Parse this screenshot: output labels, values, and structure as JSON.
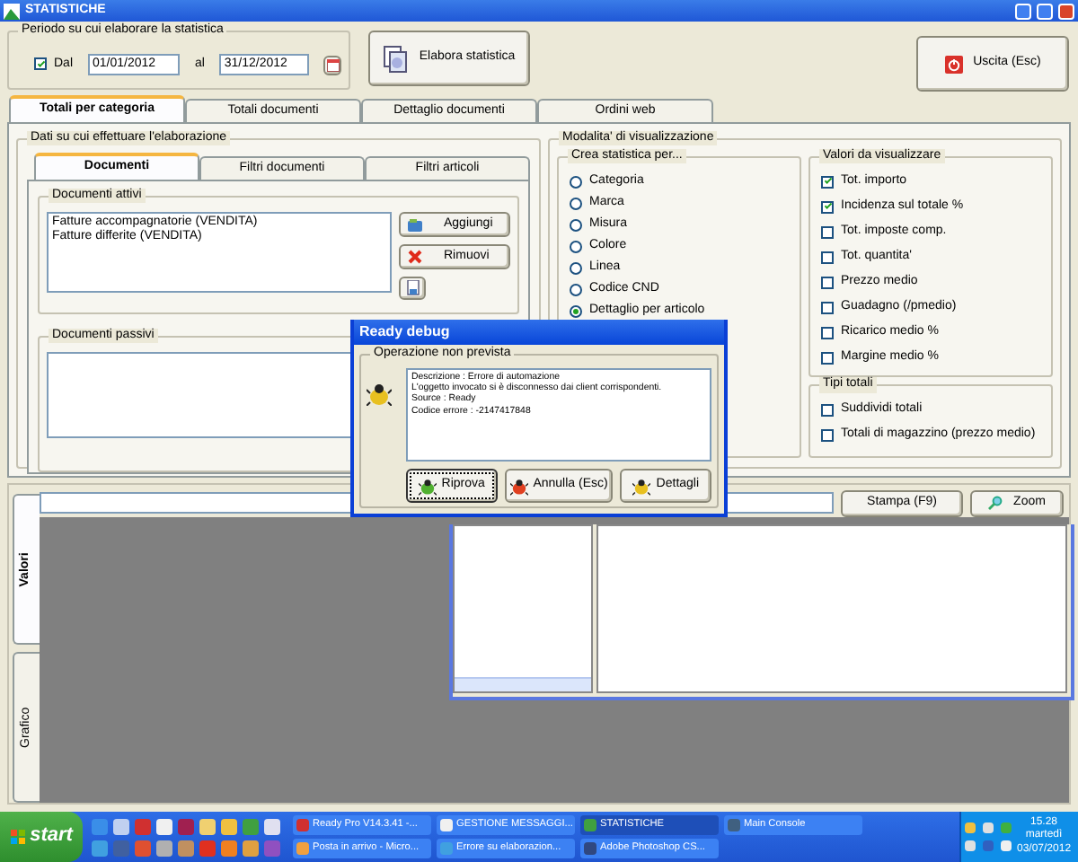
{
  "window": {
    "title": "STATISTICHE"
  },
  "period": {
    "legend": "Periodo su cui elaborare la statistica",
    "from_checked": true,
    "from_label": "Dal",
    "from": "01/01/2012",
    "to_label": "al",
    "to": "31/12/2012"
  },
  "actions": [
    {
      "label": "Elabora statistica",
      "kind": "process"
    },
    {
      "label": "Uscita (Esc)",
      "kind": "exit"
    }
  ],
  "tabs": [
    {
      "label": "Totali per categoria",
      "selected": true
    },
    {
      "label": "Totali documenti",
      "selected": false
    },
    {
      "label": "Dettaglio documenti",
      "selected": false
    },
    {
      "label": "Ordini web",
      "selected": false
    }
  ],
  "data_group": {
    "legend": "Dati su cui effettuare l'elaborazione",
    "tabs": [
      {
        "label": "Documenti",
        "selected": true
      },
      {
        "label": "Filtri documenti",
        "selected": false
      },
      {
        "label": "Filtri articoli",
        "selected": false
      }
    ],
    "active_docs": {
      "legend": "Documenti attivi",
      "items": [
        "Fatture accompagnatorie (VENDITA)",
        "Fatture differite (VENDITA)"
      ]
    },
    "buttons": [
      {
        "label": "Aggiungi",
        "kind": "add"
      },
      {
        "label": "Rimuovi",
        "kind": "remove"
      },
      {
        "kind": "edit"
      }
    ],
    "passive_docs": {
      "legend": "Documenti passivi"
    }
  },
  "view_group": {
    "legend": "Modalita' di visualizzazione",
    "create": {
      "legend": "Crea statistica per...",
      "options": [
        {
          "label": "Categoria",
          "selected": false
        },
        {
          "label": "Marca",
          "selected": false
        },
        {
          "label": "Misura",
          "selected": false
        },
        {
          "label": "Colore",
          "selected": false
        },
        {
          "label": "Linea",
          "selected": false
        },
        {
          "label": "Codice CND",
          "selected": false
        },
        {
          "label": "Dettaglio per articolo",
          "selected": true
        }
      ]
    },
    "values": {
      "legend": "Valori da visualizzare",
      "options": [
        {
          "label": "Tot. importo",
          "checked": true
        },
        {
          "label": "Incidenza sul totale %",
          "checked": true
        },
        {
          "label": "Tot. imposte comp.",
          "checked": false
        },
        {
          "label": "Tot. quantita'",
          "checked": false
        },
        {
          "label": "Prezzo medio",
          "checked": false
        },
        {
          "label": "Guadagno (/pmedio)",
          "checked": false
        },
        {
          "label": "Ricarico medio %",
          "checked": false
        },
        {
          "label": "Margine medio %",
          "checked": false
        }
      ]
    },
    "totals": {
      "legend": "Tipi totali",
      "options": [
        {
          "label": "Suddividi totali",
          "checked": false
        },
        {
          "label": "Totali di magazzino (prezzo medio)",
          "checked": false
        }
      ]
    }
  },
  "results": {
    "side_tabs": [
      {
        "label": "Valori",
        "selected": true
      },
      {
        "label": "Grafico",
        "selected": false
      }
    ],
    "buttons": [
      {
        "label": "Stampa (F9)",
        "kind": "print"
      },
      {
        "label": "Zoom",
        "kind": "zoom"
      }
    ]
  },
  "dialog": {
    "title": "Ready debug",
    "legend": "Operazione non prevista",
    "message_lines": [
      "Descrizione : Errore di automazione",
      "L'oggetto invocato si è disconnesso dai client corrispondenti.",
      "Source : Ready",
      "Codice errore : -2147417848"
    ],
    "buttons": [
      {
        "label": "Riprova",
        "kind": "retry",
        "focused": true
      },
      {
        "label": "Annulla (Esc)",
        "kind": "cancel",
        "focused": false
      },
      {
        "label": "Dettagli",
        "kind": "details",
        "focused": false
      }
    ]
  },
  "taskbar": {
    "start": "start",
    "tasks": [
      {
        "label": "Ready Pro V14.3.41 -...",
        "selected": false
      },
      {
        "label": "GESTIONE MESSAGGI...",
        "selected": false
      },
      {
        "label": "STATISTICHE",
        "selected": true
      },
      {
        "label": "Main Console",
        "selected": false
      },
      {
        "label": "Posta in arrivo - Micro...",
        "selected": false
      },
      {
        "label": "Errore su elaborazion...",
        "selected": false
      },
      {
        "label": "Adobe Photoshop CS...",
        "selected": false
      }
    ],
    "clock": {
      "time": "15.28",
      "day": "martedì",
      "date": "03/07/2012"
    }
  }
}
